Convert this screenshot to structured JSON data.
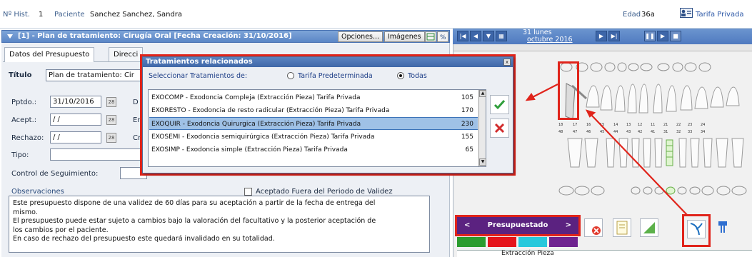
{
  "patient_bar": {
    "hist_label": "Nº Hist.",
    "hist_value": "1",
    "patient_label": "Paciente",
    "patient_name": "Sanchez Sanchez, Sandra",
    "age_label": "Edad",
    "age_value": "36a",
    "tariff": "Tarifa Privada"
  },
  "plan_header": {
    "title": "[1] - Plan de tratamiento: Cirugía Oral [Fecha Creación: 31/10/2016]",
    "options_button": "Opciones...",
    "images_button": "Imágenes"
  },
  "tabs": [
    {
      "label": "Datos del Presupuesto"
    },
    {
      "label": "Direcci"
    }
  ],
  "form": {
    "title_label": "Título",
    "title_value": "Plan de tratamiento: Cir",
    "pptdo_label": "Pptdo.:",
    "pptdo_value": "31/10/2016",
    "acept_label": "Acept.:",
    "acept_value": "/ /",
    "rechazo_label": "Rechazo:",
    "rechazo_value": "/ /",
    "tipo_label": "Tipo:",
    "seguimiento_label": "Control de Seguimiento:",
    "obs_label": "Observaciones",
    "fuera_periodo_label": "Aceptado Fuera del Periodo de Validez",
    "side_labels": [
      "D",
      "Er",
      "Cr"
    ],
    "observations": [
      "Este presupuesto dispone de una validez de 60 días para su aceptación a partir de la fecha de entrega del",
      "mismo.",
      "El presupuesto puede estar sujeto a cambios bajo la valoración del facultativo y la posterior aceptación de",
      "los cambios por el paciente.",
      "En caso de rechazo del presupuesto este quedará invalidado en su totalidad."
    ]
  },
  "calendar": {
    "date_line1": "31 lunes",
    "date_line2": "octubre 2016"
  },
  "dialog": {
    "title": "Tratamientos relacionados",
    "close_glyph": "x",
    "select_label": "Seleccionar Tratamientos de:",
    "option_default": "Tarifa Predeterminada",
    "option_all": "Todas",
    "selected_option": "Todas",
    "rows": [
      {
        "text": "EXOCOMP - Exodoncia Compleja (Extracción Pieza) Tarifa Privada",
        "value": "105"
      },
      {
        "text": "EXORESTO - Exodoncia de resto radicular (Extracción Pieza) Tarifa Privada",
        "value": "170"
      },
      {
        "text": "EXOQUIR - Exodoncia Quirurgica (Extracción Pieza) Tarifa Privada",
        "value": "230"
      },
      {
        "text": "EXOSEMI - Exodoncia semiquirúrgica (Extracción Pieza) Tarifa Privada",
        "value": "155"
      },
      {
        "text": "EXOSIMP - Exodoncia simple (Extracción Pieza) Tarifa Privada",
        "value": "65"
      }
    ],
    "selected_row": 2
  },
  "status_bar": {
    "label": "Presupuestado",
    "prev": "<",
    "next": ">",
    "bottom_text": "Extracción Pieza"
  },
  "colors": {
    "header_blue": "#5b86c6",
    "status_purple": "#5b2280",
    "highlight_red": "#e0241b",
    "confirm_green": "#2e9e3a",
    "cancel_red": "#d22d2d",
    "swatches": [
      "#2b9c2f",
      "#e5141b",
      "#27c8dc",
      "#6f2390"
    ]
  },
  "icons": [
    "person-card-icon",
    "chevron-down-icon",
    "calendar-icon",
    "check-icon",
    "cancel-icon",
    "tooth-icon",
    "implant-icon",
    "scroll-up-icon",
    "scroll-down-icon"
  ]
}
